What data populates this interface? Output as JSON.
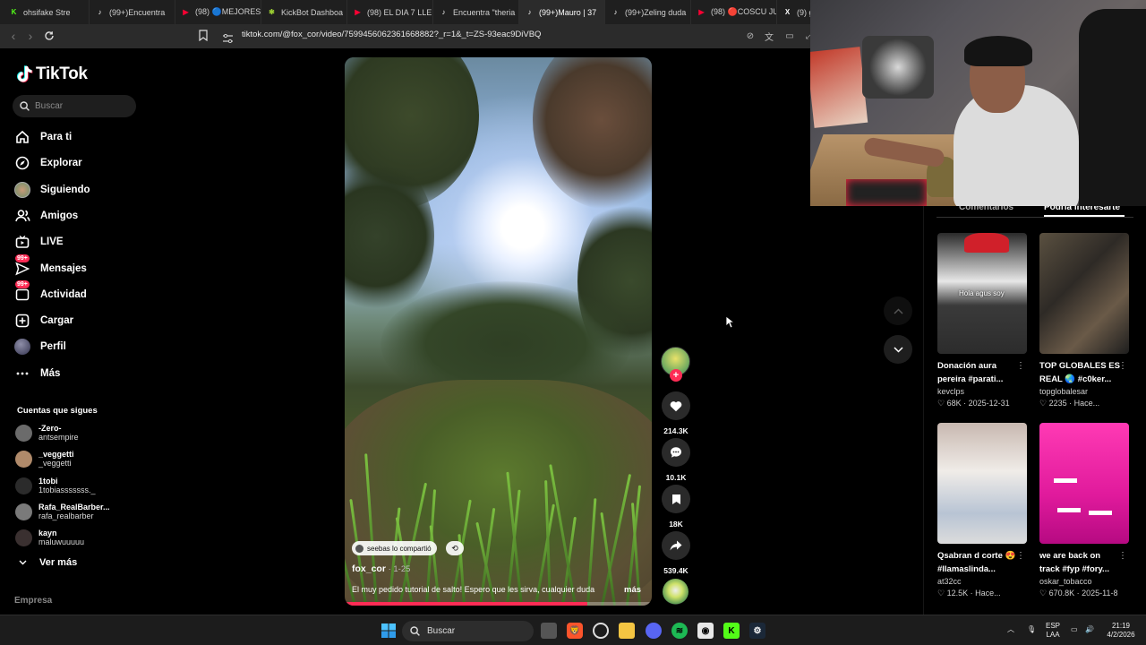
{
  "browser": {
    "tabs": [
      {
        "label": "ohsifake Stre",
        "color": "#53fc18",
        "glyph": "K"
      },
      {
        "label": "(99+)Encuentra",
        "color": "#ffffff",
        "glyph": "♪"
      },
      {
        "label": "(98) 🔵MEJORES",
        "color": "#ff0033",
        "glyph": "▶"
      },
      {
        "label": "KickBot Dashboa",
        "color": "#9acd32",
        "glyph": "✱"
      },
      {
        "label": "(98) EL DIA 7 LLE",
        "color": "#ff0033",
        "glyph": "▶"
      },
      {
        "label": "Encuentra \"theria",
        "color": "#ffffff",
        "glyph": "♪"
      },
      {
        "label": "(99+)Mauro | 37",
        "color": "#ffffff",
        "glyph": "♪"
      },
      {
        "label": "(99+)Zeling duda",
        "color": "#ffffff",
        "glyph": "♪"
      },
      {
        "label": "(98) 🔴COSCU JU",
        "color": "#ff0033",
        "glyph": "▶"
      },
      {
        "label": "(9) gon",
        "color": "#ffffff",
        "glyph": "X"
      }
    ],
    "url": "tiktok.com/@fox_cor/video/7599456062361668882?_r=1&_t=ZS-93eac9DiVBQ"
  },
  "sidebar": {
    "logo_text": "TikTok",
    "search_placeholder": "Buscar",
    "nav": [
      {
        "label": "Para ti",
        "icon": "home-icon"
      },
      {
        "label": "Explorar",
        "icon": "compass-icon"
      },
      {
        "label": "Siguiendo",
        "icon": "following-avatar-icon"
      },
      {
        "label": "Amigos",
        "icon": "friends-icon"
      },
      {
        "label": "LIVE",
        "icon": "live-tv-icon"
      },
      {
        "label": "Mensajes",
        "icon": "messages-icon",
        "badge": "99+"
      },
      {
        "label": "Actividad",
        "icon": "activity-icon",
        "badge": "99+"
      },
      {
        "label": "Cargar",
        "icon": "upload-icon"
      },
      {
        "label": "Perfil",
        "icon": "profile-icon"
      },
      {
        "label": "Más",
        "icon": "more-icon"
      }
    ],
    "following_title": "Cuentas que sigues",
    "accounts": [
      {
        "name": "-Zero-",
        "handle": "antsempire",
        "color": "#6b6b6b"
      },
      {
        "name": "_veggetti",
        "handle": "_veggetti",
        "color": "#b08a6a"
      },
      {
        "name": "1tobi",
        "handle": "1tobiasssssss._",
        "color": "#2b2b2b"
      },
      {
        "name": "Rafa_RealBarber...",
        "handle": "rafa_realbarber",
        "color": "#7a7a7a"
      },
      {
        "name": "kayn",
        "handle": "maluwuuuuu",
        "color": "#3a3030"
      }
    ],
    "see_more": "Ver más",
    "company": "Empresa"
  },
  "video": {
    "shared_by": "seebas lo compartió",
    "author": "fox_cor",
    "date": " · 1-25",
    "caption": "El muy pedido tutorial de salto! Espero que les sirva, cualquier duda",
    "more": "más",
    "progress": 0.79
  },
  "actions": {
    "likes": "214.3K",
    "comments": "10.1K",
    "saves": "18K",
    "shares": "539.4K"
  },
  "right_panel": {
    "tab_comments": "Comentarios",
    "tab_suggested": "Podría interesarte",
    "cards": [
      {
        "title": "Donación aura pereira #parati...",
        "user": "kevclps",
        "likes": "68K",
        "date": "2025-12-31",
        "overlay": "Hola agus soy"
      },
      {
        "title": "TOP GLOBALES ES REAL 🌏 #c0ker...",
        "user": "topglobalesar",
        "likes": "2235",
        "date": "Hace..."
      },
      {
        "title": "Qsabran d corte 😍#llamaslinda...",
        "user": "at32cc",
        "likes": "12.5K",
        "date": "Hace..."
      },
      {
        "title": "we are back on track #fyp #fory...",
        "user": "oskar_tobacco",
        "likes": "670.8K",
        "date": "2025-11-8"
      }
    ]
  },
  "taskbar": {
    "search_label": "Buscar",
    "lang_top": "ESP",
    "lang_bottom": "LAA",
    "time": "21:19",
    "date": "4/2/2026"
  },
  "colors": {
    "accent": "#fe2c55",
    "background": "#000000"
  }
}
